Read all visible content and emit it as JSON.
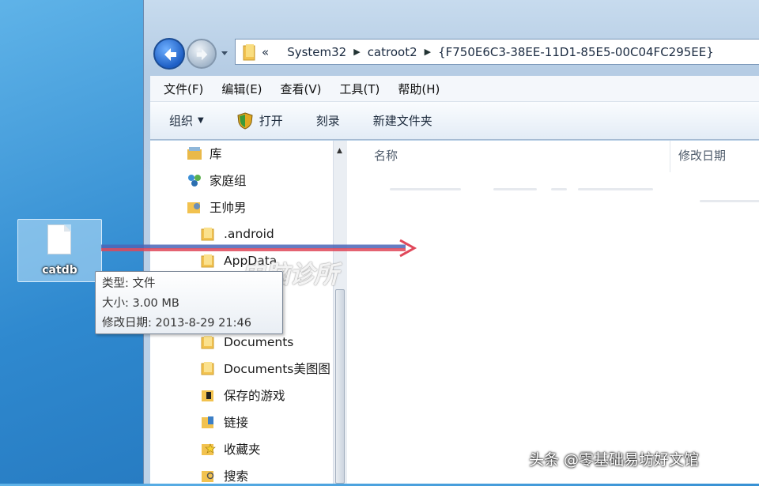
{
  "desktop": {
    "file_icon_label": "catdb"
  },
  "window": {
    "address_bar": {
      "overflow_chevron": "«",
      "segments": [
        "System32",
        "catroot2",
        "{F750E6C3-38EE-11D1-85E5-00C04FC295EE}"
      ]
    },
    "menu_bar": [
      "文件(F)",
      "编辑(E)",
      "查看(V)",
      "工具(T)",
      "帮助(H)"
    ],
    "toolbar": {
      "organize": "组织",
      "open": "打开",
      "burn": "刻录",
      "new_folder": "新建文件夹"
    },
    "nav_pane": {
      "items": [
        "库",
        "家庭组",
        "王帅男",
        ".android",
        "AppData",
        "Documents",
        "Documents美图图",
        "保存的游戏",
        "链接",
        "收藏夹",
        "搜索"
      ]
    },
    "file_list": {
      "columns": [
        "名称",
        "修改日期"
      ]
    }
  },
  "tooltip": {
    "type_line": "类型: 文件",
    "size_line": "大小: 3.00 MB",
    "date_line": "修改日期: 2013-8-29 21:46"
  },
  "overlay": {
    "watermark": "电脑诊所",
    "credit": "头条 @零基础易坊好文馆"
  },
  "colors": {
    "desktop_bg": "#2f89cf",
    "window_chrome": "#c7dbee",
    "drag_arrow": "#e0485a"
  }
}
